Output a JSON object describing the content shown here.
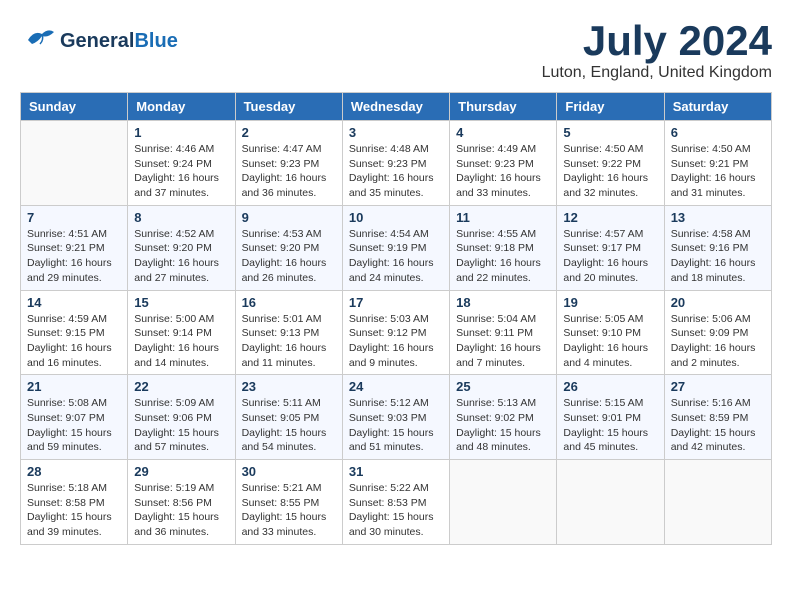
{
  "logo": {
    "general": "General",
    "blue": "Blue"
  },
  "title": {
    "month_year": "July 2024",
    "location": "Luton, England, United Kingdom"
  },
  "weekdays": [
    "Sunday",
    "Monday",
    "Tuesday",
    "Wednesday",
    "Thursday",
    "Friday",
    "Saturday"
  ],
  "weeks": [
    [
      {
        "day": "",
        "sunrise": "",
        "sunset": "",
        "daylight": ""
      },
      {
        "day": "1",
        "sunrise": "Sunrise: 4:46 AM",
        "sunset": "Sunset: 9:24 PM",
        "daylight": "Daylight: 16 hours and 37 minutes."
      },
      {
        "day": "2",
        "sunrise": "Sunrise: 4:47 AM",
        "sunset": "Sunset: 9:23 PM",
        "daylight": "Daylight: 16 hours and 36 minutes."
      },
      {
        "day": "3",
        "sunrise": "Sunrise: 4:48 AM",
        "sunset": "Sunset: 9:23 PM",
        "daylight": "Daylight: 16 hours and 35 minutes."
      },
      {
        "day": "4",
        "sunrise": "Sunrise: 4:49 AM",
        "sunset": "Sunset: 9:23 PM",
        "daylight": "Daylight: 16 hours and 33 minutes."
      },
      {
        "day": "5",
        "sunrise": "Sunrise: 4:50 AM",
        "sunset": "Sunset: 9:22 PM",
        "daylight": "Daylight: 16 hours and 32 minutes."
      },
      {
        "day": "6",
        "sunrise": "Sunrise: 4:50 AM",
        "sunset": "Sunset: 9:21 PM",
        "daylight": "Daylight: 16 hours and 31 minutes."
      }
    ],
    [
      {
        "day": "7",
        "sunrise": "Sunrise: 4:51 AM",
        "sunset": "Sunset: 9:21 PM",
        "daylight": "Daylight: 16 hours and 29 minutes."
      },
      {
        "day": "8",
        "sunrise": "Sunrise: 4:52 AM",
        "sunset": "Sunset: 9:20 PM",
        "daylight": "Daylight: 16 hours and 27 minutes."
      },
      {
        "day": "9",
        "sunrise": "Sunrise: 4:53 AM",
        "sunset": "Sunset: 9:20 PM",
        "daylight": "Daylight: 16 hours and 26 minutes."
      },
      {
        "day": "10",
        "sunrise": "Sunrise: 4:54 AM",
        "sunset": "Sunset: 9:19 PM",
        "daylight": "Daylight: 16 hours and 24 minutes."
      },
      {
        "day": "11",
        "sunrise": "Sunrise: 4:55 AM",
        "sunset": "Sunset: 9:18 PM",
        "daylight": "Daylight: 16 hours and 22 minutes."
      },
      {
        "day": "12",
        "sunrise": "Sunrise: 4:57 AM",
        "sunset": "Sunset: 9:17 PM",
        "daylight": "Daylight: 16 hours and 20 minutes."
      },
      {
        "day": "13",
        "sunrise": "Sunrise: 4:58 AM",
        "sunset": "Sunset: 9:16 PM",
        "daylight": "Daylight: 16 hours and 18 minutes."
      }
    ],
    [
      {
        "day": "14",
        "sunrise": "Sunrise: 4:59 AM",
        "sunset": "Sunset: 9:15 PM",
        "daylight": "Daylight: 16 hours and 16 minutes."
      },
      {
        "day": "15",
        "sunrise": "Sunrise: 5:00 AM",
        "sunset": "Sunset: 9:14 PM",
        "daylight": "Daylight: 16 hours and 14 minutes."
      },
      {
        "day": "16",
        "sunrise": "Sunrise: 5:01 AM",
        "sunset": "Sunset: 9:13 PM",
        "daylight": "Daylight: 16 hours and 11 minutes."
      },
      {
        "day": "17",
        "sunrise": "Sunrise: 5:03 AM",
        "sunset": "Sunset: 9:12 PM",
        "daylight": "Daylight: 16 hours and 9 minutes."
      },
      {
        "day": "18",
        "sunrise": "Sunrise: 5:04 AM",
        "sunset": "Sunset: 9:11 PM",
        "daylight": "Daylight: 16 hours and 7 minutes."
      },
      {
        "day": "19",
        "sunrise": "Sunrise: 5:05 AM",
        "sunset": "Sunset: 9:10 PM",
        "daylight": "Daylight: 16 hours and 4 minutes."
      },
      {
        "day": "20",
        "sunrise": "Sunrise: 5:06 AM",
        "sunset": "Sunset: 9:09 PM",
        "daylight": "Daylight: 16 hours and 2 minutes."
      }
    ],
    [
      {
        "day": "21",
        "sunrise": "Sunrise: 5:08 AM",
        "sunset": "Sunset: 9:07 PM",
        "daylight": "Daylight: 15 hours and 59 minutes."
      },
      {
        "day": "22",
        "sunrise": "Sunrise: 5:09 AM",
        "sunset": "Sunset: 9:06 PM",
        "daylight": "Daylight: 15 hours and 57 minutes."
      },
      {
        "day": "23",
        "sunrise": "Sunrise: 5:11 AM",
        "sunset": "Sunset: 9:05 PM",
        "daylight": "Daylight: 15 hours and 54 minutes."
      },
      {
        "day": "24",
        "sunrise": "Sunrise: 5:12 AM",
        "sunset": "Sunset: 9:03 PM",
        "daylight": "Daylight: 15 hours and 51 minutes."
      },
      {
        "day": "25",
        "sunrise": "Sunrise: 5:13 AM",
        "sunset": "Sunset: 9:02 PM",
        "daylight": "Daylight: 15 hours and 48 minutes."
      },
      {
        "day": "26",
        "sunrise": "Sunrise: 5:15 AM",
        "sunset": "Sunset: 9:01 PM",
        "daylight": "Daylight: 15 hours and 45 minutes."
      },
      {
        "day": "27",
        "sunrise": "Sunrise: 5:16 AM",
        "sunset": "Sunset: 8:59 PM",
        "daylight": "Daylight: 15 hours and 42 minutes."
      }
    ],
    [
      {
        "day": "28",
        "sunrise": "Sunrise: 5:18 AM",
        "sunset": "Sunset: 8:58 PM",
        "daylight": "Daylight: 15 hours and 39 minutes."
      },
      {
        "day": "29",
        "sunrise": "Sunrise: 5:19 AM",
        "sunset": "Sunset: 8:56 PM",
        "daylight": "Daylight: 15 hours and 36 minutes."
      },
      {
        "day": "30",
        "sunrise": "Sunrise: 5:21 AM",
        "sunset": "Sunset: 8:55 PM",
        "daylight": "Daylight: 15 hours and 33 minutes."
      },
      {
        "day": "31",
        "sunrise": "Sunrise: 5:22 AM",
        "sunset": "Sunset: 8:53 PM",
        "daylight": "Daylight: 15 hours and 30 minutes."
      },
      {
        "day": "",
        "sunrise": "",
        "sunset": "",
        "daylight": ""
      },
      {
        "day": "",
        "sunrise": "",
        "sunset": "",
        "daylight": ""
      },
      {
        "day": "",
        "sunrise": "",
        "sunset": "",
        "daylight": ""
      }
    ]
  ]
}
